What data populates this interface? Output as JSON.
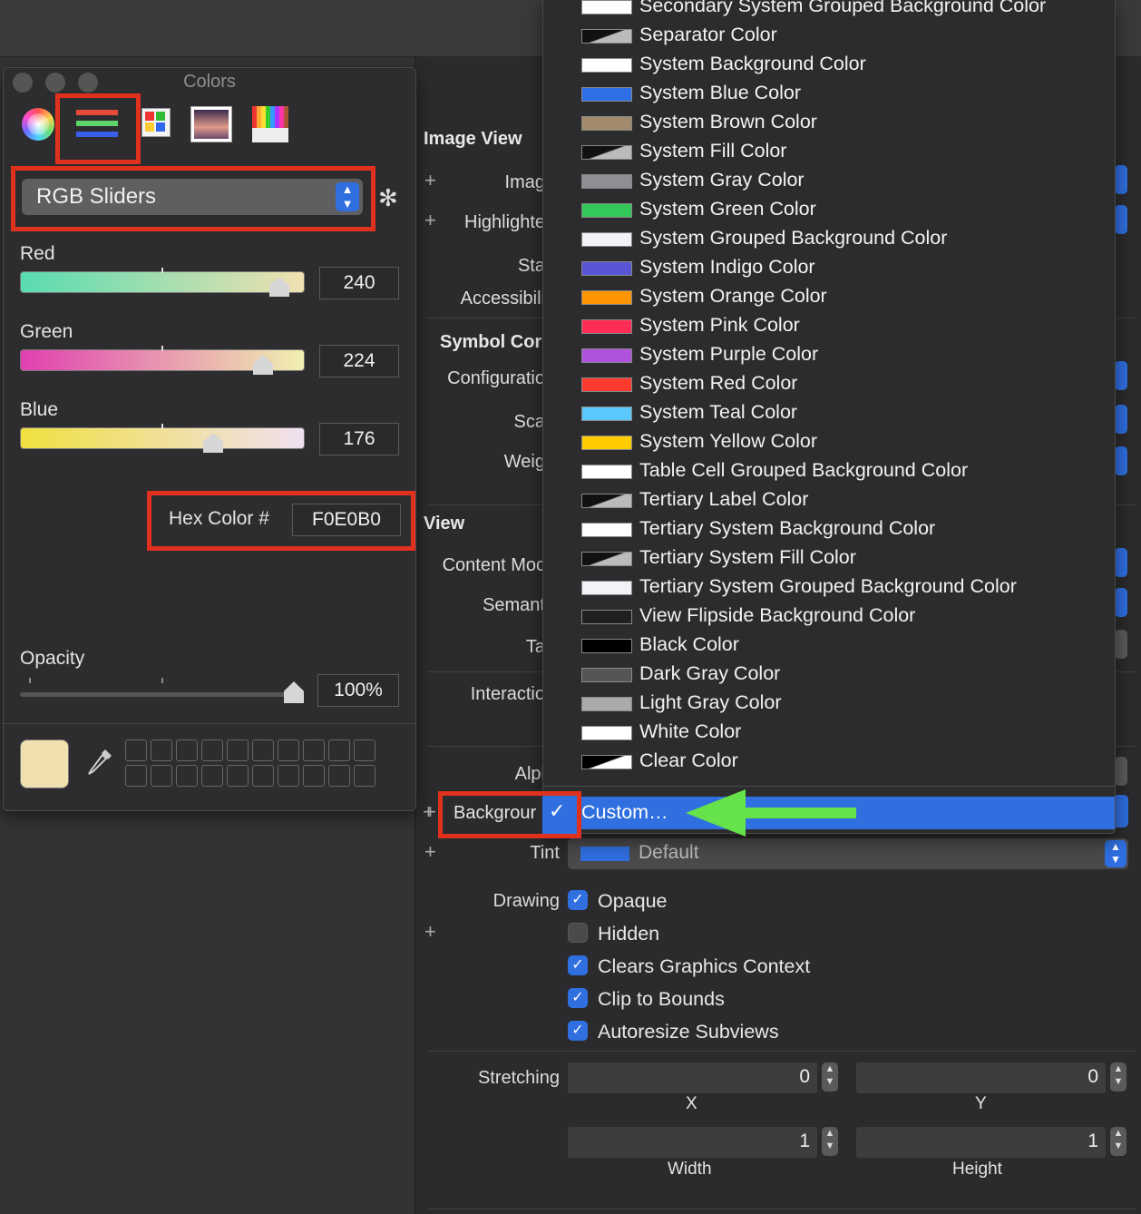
{
  "colors_panel": {
    "title": "Colors",
    "mode_select": "RGB Sliders",
    "sliders": [
      {
        "label": "Red",
        "value": "240"
      },
      {
        "label": "Green",
        "value": "224"
      },
      {
        "label": "Blue",
        "value": "176"
      }
    ],
    "hex_label": "Hex Color #",
    "hex_value": "F0E0B0",
    "opacity_label": "Opacity",
    "opacity_value": "100%",
    "current_color": "#F0E0B0"
  },
  "inspector": {
    "image_view": {
      "title": "Image View",
      "labels": [
        "Imag",
        "Highlighte",
        "Sta",
        "Accessibili"
      ]
    },
    "symbol": {
      "title": "Symbol Cor",
      "labels": [
        "Configuratio",
        "Sca",
        "Weig"
      ]
    },
    "view": {
      "title": "View",
      "labels": [
        "Content Moc",
        "Semant",
        "Ta",
        "Interactio",
        "Alpl"
      ]
    },
    "background_label": "Backgrour",
    "tint_label": "Tint",
    "tint_value": "Default",
    "drawing_label": "Drawing",
    "drawing_options": [
      {
        "label": "Opaque",
        "checked": true
      },
      {
        "label": "Hidden",
        "checked": false
      },
      {
        "label": "Clears Graphics Context",
        "checked": true
      },
      {
        "label": "Clip to Bounds",
        "checked": true
      },
      {
        "label": "Autoresize Subviews",
        "checked": true
      }
    ],
    "stretching_label": "Stretching",
    "stretch_x": "0",
    "stretch_y": "0",
    "stretch_w": "1",
    "stretch_h": "1",
    "x_label": "X",
    "y_label": "Y",
    "width_label": "Width",
    "height_label": "Height"
  },
  "menu": {
    "items": [
      {
        "label": "Secondary System Grouped Background Color",
        "swatch": "#ffffff"
      },
      {
        "label": "Separator Color",
        "swatch": "diag"
      },
      {
        "label": "System Background Color",
        "swatch": "#ffffff"
      },
      {
        "label": "System Blue Color",
        "swatch": "#2f6fe8"
      },
      {
        "label": "System Brown Color",
        "swatch": "#a28b6c"
      },
      {
        "label": "System Fill Color",
        "swatch": "diag"
      },
      {
        "label": "System Gray Color",
        "swatch": "#8e8e93"
      },
      {
        "label": "System Green Color",
        "swatch": "#34c759"
      },
      {
        "label": "System Grouped Background Color",
        "swatch": "#f2f2f7"
      },
      {
        "label": "System Indigo Color",
        "swatch": "#5856d6"
      },
      {
        "label": "System Orange Color",
        "swatch": "#ff9500"
      },
      {
        "label": "System Pink Color",
        "swatch": "#ff2d55"
      },
      {
        "label": "System Purple Color",
        "swatch": "#af52de"
      },
      {
        "label": "System Red Color",
        "swatch": "#ff3b30"
      },
      {
        "label": "System Teal Color",
        "swatch": "#5ac8fa"
      },
      {
        "label": "System Yellow Color",
        "swatch": "#ffcc00"
      },
      {
        "label": "Table Cell Grouped Background Color",
        "swatch": "#ffffff"
      },
      {
        "label": "Tertiary Label Color",
        "swatch": "diag"
      },
      {
        "label": "Tertiary System Background Color",
        "swatch": "#ffffff"
      },
      {
        "label": "Tertiary System Fill Color",
        "swatch": "diag"
      },
      {
        "label": "Tertiary System Grouped Background Color",
        "swatch": "#f2f2f7"
      },
      {
        "label": "View Flipside Background Color",
        "swatch": "#1f1f21"
      },
      {
        "label": "Black Color",
        "swatch": "#000000"
      },
      {
        "label": "Dark Gray Color",
        "swatch": "#555555"
      },
      {
        "label": "Light Gray Color",
        "swatch": "#aaaaaa"
      },
      {
        "label": "White Color",
        "swatch": "#ffffff"
      },
      {
        "label": "Clear Color",
        "swatch": "clear"
      }
    ],
    "selected_label": "Custom…",
    "checkmark": "✓"
  }
}
